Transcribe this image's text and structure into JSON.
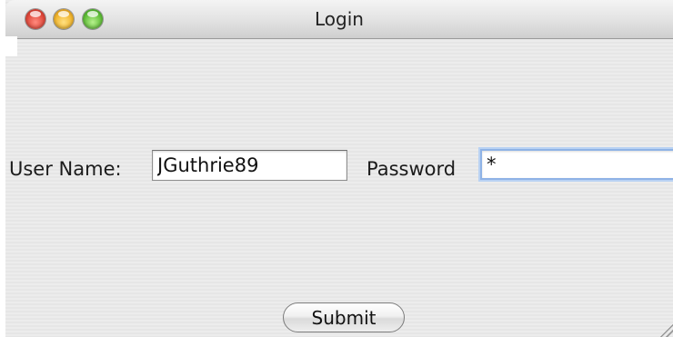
{
  "window": {
    "title": "Login"
  },
  "form": {
    "username_label": "User Name:",
    "username_value": "JGuthrie89",
    "password_label": "Password",
    "password_value": "*",
    "submit_label": "Submit"
  },
  "icons": [
    "close-icon",
    "minimize-icon",
    "zoom-icon",
    "resize-grip-icon"
  ],
  "colors": {
    "close": "#e0493c",
    "minimize": "#f1b52d",
    "zoom": "#62bf3a",
    "focus_ring": "#8fb3e6"
  }
}
